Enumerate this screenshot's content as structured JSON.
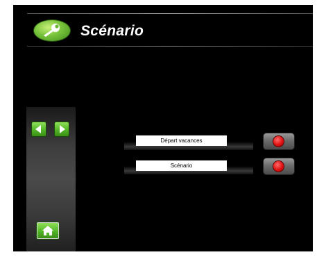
{
  "header": {
    "title": "Scénario",
    "logo_icon": "wrench-icon"
  },
  "navigation": {
    "prev_icon": "triangle-left-icon",
    "next_icon": "triangle-right-icon",
    "home_icon": "home-icon"
  },
  "scenarios": [
    {
      "label": "Départ vacances",
      "action_icon": "red-circle-icon"
    },
    {
      "label": "Scénario",
      "action_icon": "red-circle-icon"
    }
  ],
  "colors": {
    "background": "#000000",
    "accent_green": "#52b527",
    "action_red": "#e01010",
    "label_bg": "#ffffff"
  }
}
